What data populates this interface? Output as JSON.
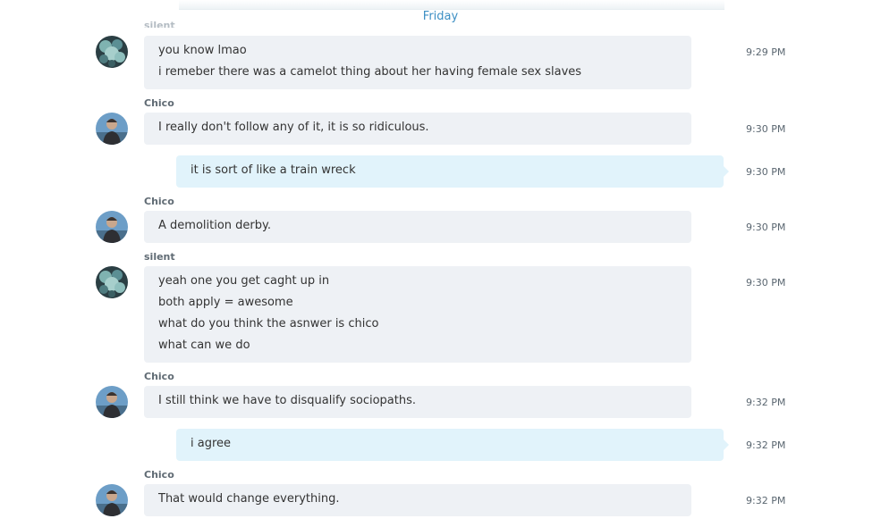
{
  "day_separator": "Friday",
  "cut_off_sender": "silent",
  "messages": [
    {
      "sender": "",
      "time": "9:29 PM",
      "lines": [
        "you know lmao",
        "i remeber there was a camelot thing about her having female sex slaves"
      ]
    },
    {
      "sender": "Chico",
      "time": "9:30 PM",
      "lines": [
        "I really don't follow any of it, it is so ridiculous."
      ]
    },
    {
      "sender": "",
      "time": "9:30 PM",
      "lines": [
        "it is sort of like a train wreck"
      ]
    },
    {
      "sender": "Chico",
      "time": "9:30 PM",
      "lines": [
        "A demolition derby."
      ]
    },
    {
      "sender": "silent",
      "time": "9:30 PM",
      "lines": [
        "yeah one you get caght up in",
        "both apply = awesome",
        "what do you think the asnwer is chico",
        "what can we do"
      ]
    },
    {
      "sender": "Chico",
      "time": "9:32 PM",
      "lines": [
        "I still think we have to disqualify sociopaths."
      ]
    },
    {
      "sender": "",
      "time": "9:32 PM",
      "lines": [
        "i agree"
      ]
    },
    {
      "sender": "Chico",
      "time": "9:32 PM",
      "lines": [
        "That would change everything."
      ]
    }
  ],
  "colors": {
    "incoming_bubble": "#eef1f5",
    "outgoing_bubble": "#e1f3fb",
    "day_separator": "#3d8fc4"
  },
  "icons": {
    "silent_avatar": "teal-blossom-avatar",
    "chico_avatar": "person-photo-avatar"
  }
}
